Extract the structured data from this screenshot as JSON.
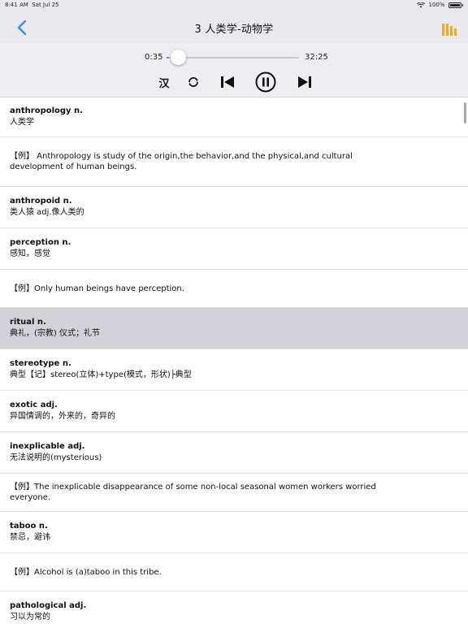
{
  "status": {
    "time": "8:41 AM",
    "date": "Sat Jul 25",
    "battery": "100%"
  },
  "nav": {
    "title": "3 人类学-动物学"
  },
  "player": {
    "current_time": "0:35",
    "total_time": "32:25",
    "progress": 0.018,
    "lang_label": "汉"
  },
  "colors": {
    "accent": "#3a8ee6",
    "bars_icon": "#f5a623",
    "selected_row": "#d2d2d8"
  },
  "rows": [
    {
      "type": "word",
      "term": "anthropology n.",
      "meaning": "人类学"
    },
    {
      "type": "example",
      "text": "【例】 Anthropology is study of the origin,the behavior,and the physical,and cultural development of human beings."
    },
    {
      "type": "word",
      "term": "anthropoid n.",
      "meaning": "类人猿 adj.像人类的"
    },
    {
      "type": "word",
      "term": "perception n.",
      "meaning": "感知，感觉"
    },
    {
      "type": "example",
      "text": "【例】Only human beings have perception."
    },
    {
      "type": "word",
      "term": "ritual n.",
      "meaning": "典礼，(宗教) 仪式；礼节",
      "selected": true
    },
    {
      "type": "word",
      "term": "stereotype n.",
      "meaning": "典型【记】stereo(立体)+type(模式，形状)├典型"
    },
    {
      "type": "word",
      "term": "exotic adj.",
      "meaning": "异国情调的，外来的，奇异的"
    },
    {
      "type": "word",
      "term": "inexplicable adj.",
      "meaning": "无法说明的(mysterious)"
    },
    {
      "type": "example",
      "text": "【例】The inexplicable disappearance of some non-local seasonal women workers worried everyone."
    },
    {
      "type": "word",
      "term": "taboo n.",
      "meaning": "禁忌，避讳"
    },
    {
      "type": "example",
      "text": "【例】Alcohol is (a)taboo in this tribe."
    },
    {
      "type": "word",
      "term": "pathological adj.",
      "meaning": "习以为常的"
    }
  ]
}
